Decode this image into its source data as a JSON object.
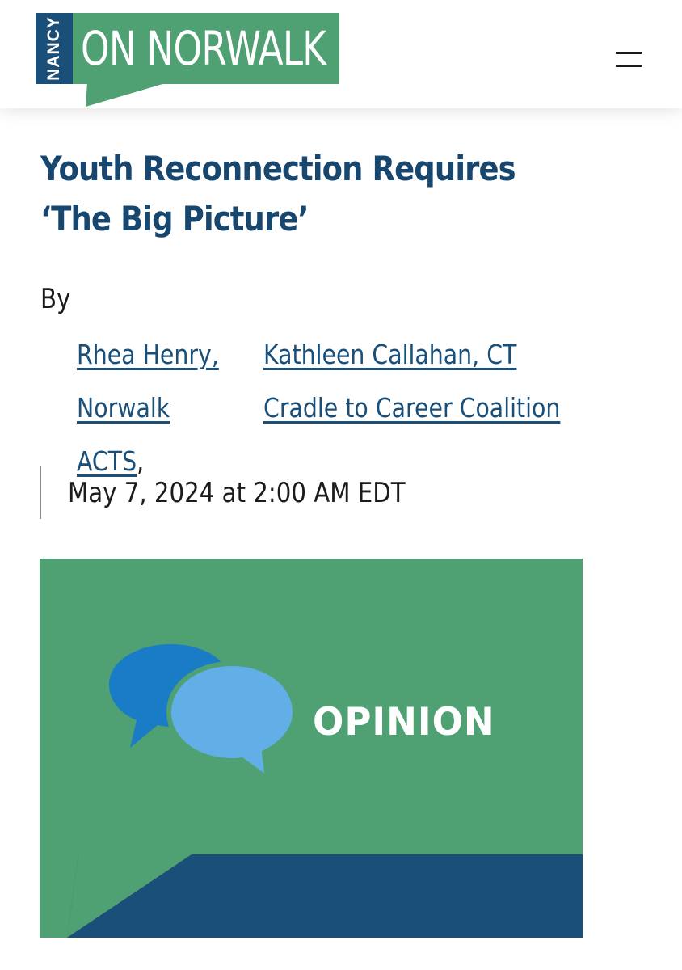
{
  "header": {
    "logo": {
      "side_text": "NANCY",
      "main_text": "ON NORWALK"
    },
    "menu_icon": "hamburger-menu-icon"
  },
  "article": {
    "title": "Youth Reconnection Requires ‘The Big Picture’",
    "byline_prefix": "By",
    "authors": [
      {
        "name": "Rhea Henry, Norwalk ACTS",
        "separator": ","
      },
      {
        "name": "Kathleen Callahan, CT Cradle to Career Coalition",
        "separator": ""
      }
    ],
    "date": "May 7, 2024 at 2:00 AM EDT",
    "hero_image": {
      "label": "OPINION",
      "icon": "speech-bubbles-icon"
    }
  },
  "colors": {
    "brand_green": "#4fa073",
    "brand_navy": "#1a4f79",
    "title_navy": "#17466f",
    "bubble_dark": "#1a7cc6",
    "bubble_light": "#62aee6"
  }
}
